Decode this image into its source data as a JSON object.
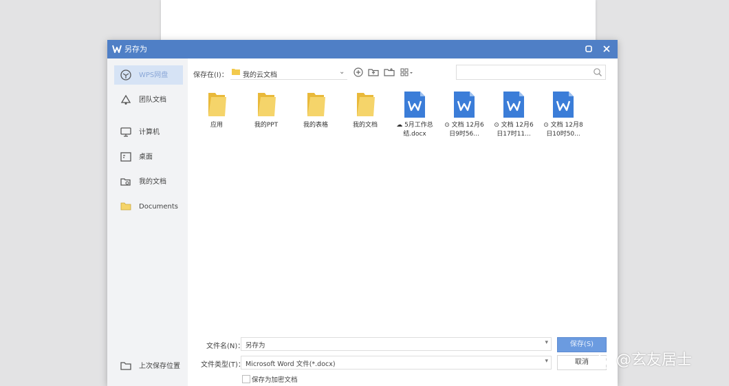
{
  "window": {
    "title": "另存为"
  },
  "sidebar": {
    "items": [
      {
        "label": "WPS网盘",
        "icon": "cube-icon"
      },
      {
        "label": "团队文档",
        "icon": "team-icon"
      },
      {
        "label": "计算机",
        "icon": "computer-icon"
      },
      {
        "label": "桌面",
        "icon": "desktop-icon"
      },
      {
        "label": "我的文档",
        "icon": "my-docs-icon"
      },
      {
        "label": "Documents",
        "icon": "folder-icon"
      }
    ],
    "last_location": "上次保存位置"
  },
  "path": {
    "label": "保存在(I)：",
    "value": "我的云文档"
  },
  "files": [
    {
      "name": "应用",
      "type": "folder"
    },
    {
      "name": "我的PPT",
      "type": "folder"
    },
    {
      "name": "我的表格",
      "type": "folder"
    },
    {
      "name": "我的文档",
      "type": "folder"
    },
    {
      "name": "☁ 5月工作总\n结.docx",
      "type": "wps"
    },
    {
      "name": "⊙ 文档 12月6\n日9时56...",
      "type": "wps"
    },
    {
      "name": "⊙ 文档 12月6\n日17时11...",
      "type": "wps"
    },
    {
      "name": "⊙ 文档 12月8\n日10时50...",
      "type": "wps"
    }
  ],
  "form": {
    "filename_label": "文件名(N)：",
    "filename_value": "另存为",
    "filetype_label": "文件类型(T)：",
    "filetype_value": "Microsoft Word 文件(*.docx)",
    "save_label": "保存(S)",
    "cancel_label": "取消",
    "checkbox_label": "保存为加密文档"
  },
  "watermark": {
    "text": "@玄友居士"
  },
  "colors": {
    "titlebar": "#4f7fc6",
    "accent": "#6b9be0",
    "folder": "#f2c94c",
    "wps_doc": "#3b7dd8"
  }
}
